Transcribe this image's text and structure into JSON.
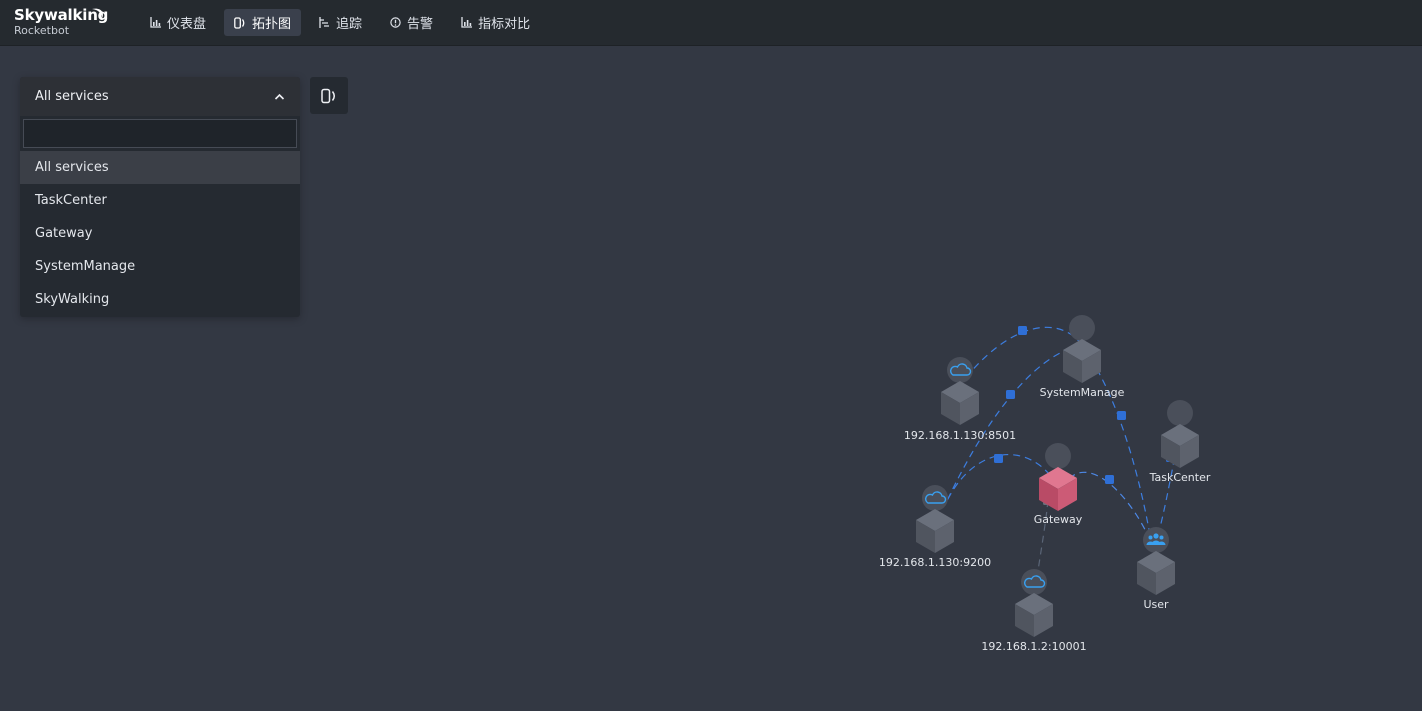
{
  "app": {
    "logo_title": "Skywalking",
    "logo_subtitle": "Rocketbot"
  },
  "nav": {
    "items": [
      {
        "label": "仪表盘",
        "icon": "bar-chart-icon"
      },
      {
        "label": "拓扑图",
        "icon": "topology-icon",
        "active": true
      },
      {
        "label": "追踪",
        "icon": "trace-icon"
      },
      {
        "label": "告警",
        "icon": "alarm-icon"
      },
      {
        "label": "指标对比",
        "icon": "bar-chart-icon"
      }
    ]
  },
  "service_selector": {
    "selected": "All services",
    "search_value": "",
    "options": [
      "All services",
      "TaskCenter",
      "Gateway",
      "SystemManage",
      "SkyWalking"
    ]
  },
  "topology": {
    "nodes": [
      {
        "name": "SystemManage",
        "kind": "service"
      },
      {
        "name": "192.168.1.130:8501",
        "kind": "database"
      },
      {
        "name": "TaskCenter",
        "kind": "service"
      },
      {
        "name": "Gateway",
        "kind": "service-alert"
      },
      {
        "name": "192.168.1.130:9200",
        "kind": "database"
      },
      {
        "name": "User",
        "kind": "user"
      },
      {
        "name": "192.168.1.2:10001",
        "kind": "database"
      }
    ]
  },
  "colors": {
    "background": "#333843",
    "header": "#252a2f",
    "link": "#3d7ee0",
    "alert_node": "#d45c78",
    "cube": "#5c616d"
  }
}
